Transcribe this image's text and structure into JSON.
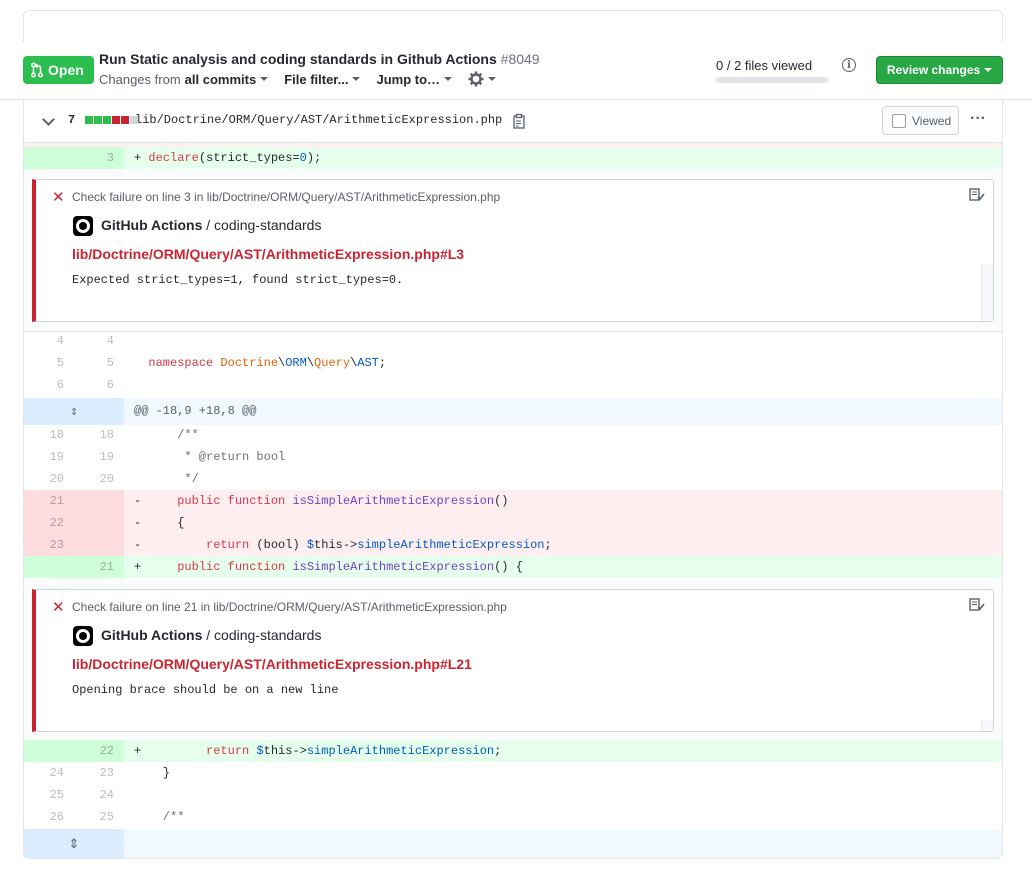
{
  "pr": {
    "status": "Open",
    "title": "Run Static analysis and coding standards in Github Actions",
    "number": "#8049",
    "changes_from_label": "Changes from",
    "changes_from_value": "all commits",
    "file_filter": "File filter...",
    "jump_to": "Jump to…",
    "files_viewed": "0 / 2 files viewed",
    "files_viewed_progress": 0,
    "review_button": "Review changes",
    "colors": {
      "open": "#2cbe4e",
      "review": "#28a745",
      "error": "#cb2431"
    }
  },
  "file": {
    "changes_count": "7",
    "diffstat": [
      "added",
      "added",
      "added",
      "deleted",
      "deleted",
      "neutral"
    ],
    "path": "lib/Doctrine/ORM/Query/AST/ArithmeticExpression.php",
    "viewed_label": "Viewed",
    "viewed_checked": false,
    "more_icon": "kebab-horizontal-icon"
  },
  "rows_top": [
    {
      "type": "add",
      "old": "",
      "new": "3",
      "sign": "+",
      "text": "declare(strict_types=0);"
    }
  ],
  "annotations": [
    {
      "location": "Check failure on line 3 in lib/Doctrine/ORM/Query/AST/ArithmeticExpression.php",
      "app": "GitHub Actions",
      "check": " / coding-standards",
      "link": "lib/Doctrine/ORM/Query/AST/ArithmeticExpression.php#L3",
      "message": "Expected strict_types=1, found strict_types=0."
    },
    {
      "location": "Check failure on line 21 in lib/Doctrine/ORM/Query/AST/ArithmeticExpression.php",
      "app": "GitHub Actions",
      "check": " / coding-standards",
      "link": "lib/Doctrine/ORM/Query/AST/ArithmeticExpression.php#L21",
      "message": "Opening brace should be on a new line"
    }
  ],
  "rows_mid": [
    {
      "old": "4",
      "new": "4",
      "text": ""
    },
    {
      "old": "5",
      "new": "5",
      "text": "namespace Doctrine\\ORM\\Query\\AST;"
    },
    {
      "old": "6",
      "new": "6",
      "text": ""
    }
  ],
  "hunk1": "@@ -18,9 +18,8 @@",
  "rows_hunk": [
    {
      "old": "18",
      "new": "18",
      "text": "    /**"
    },
    {
      "old": "19",
      "new": "19",
      "text": "     * @return bool"
    },
    {
      "old": "20",
      "new": "20",
      "text": "     */"
    },
    {
      "old": "21",
      "new": "",
      "sign": "-",
      "text": "    public function isSimpleArithmeticExpression()"
    },
    {
      "old": "22",
      "new": "",
      "sign": "-",
      "text": "    {"
    },
    {
      "old": "23",
      "new": "",
      "sign": "-",
      "text": "        return (bool) $this->simpleArithmeticExpression;"
    },
    {
      "old": "",
      "new": "21",
      "sign": "+",
      "text": "    public function isSimpleArithmeticExpression() {"
    }
  ],
  "rows_bottom": [
    {
      "old": "",
      "new": "22",
      "sign": "+",
      "text": "        return $this->simpleArithmeticExpression;"
    },
    {
      "old": "24",
      "new": "23",
      "text": "    }"
    },
    {
      "old": "25",
      "new": "24",
      "text": ""
    },
    {
      "old": "26",
      "new": "25",
      "text": "    /**"
    }
  ]
}
